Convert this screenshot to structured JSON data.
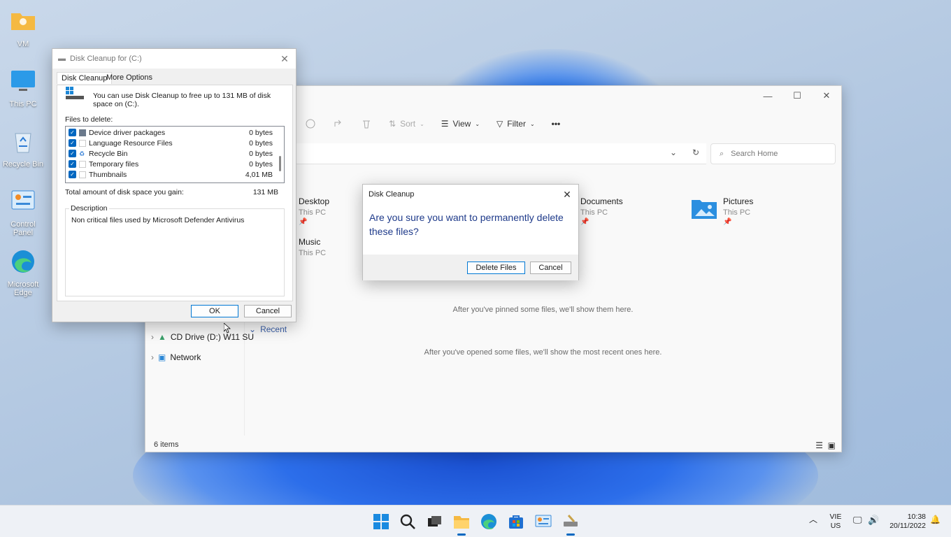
{
  "desktop": {
    "icons": [
      {
        "label": "VM",
        "icon": "folder-icon"
      },
      {
        "label": "This PC",
        "icon": "monitor-icon"
      },
      {
        "label": "Recycle Bin",
        "icon": "recycle-bin-icon"
      },
      {
        "label": "Control Panel",
        "icon": "control-panel-icon"
      },
      {
        "label": "Microsoft Edge",
        "icon": "edge-icon"
      }
    ]
  },
  "explorer": {
    "toolbar": {
      "sort": "Sort",
      "view": "View",
      "filter": "Filter",
      "more": "•••"
    },
    "search_placeholder": "Search Home",
    "nav": {
      "recent": "Recent",
      "cd_drive": "CD Drive (D:) W11 SU",
      "network": "Network"
    },
    "quick_access": [
      {
        "name": "Desktop",
        "location": "This PC"
      },
      {
        "name": "Music",
        "location": "This PC"
      },
      {
        "name": "Documents",
        "location": "This PC"
      },
      {
        "name": "Pictures",
        "location": "This PC"
      }
    ],
    "favorites_empty": "After you've pinned some files, we'll show them here.",
    "recent_empty": "After you've opened some files, we'll show the most recent ones here.",
    "status": "6 items"
  },
  "disk_cleanup": {
    "title": "Disk Cleanup for  (C:)",
    "tabs": [
      "Disk Cleanup",
      "More Options"
    ],
    "intro": "You can use Disk Cleanup to free up to 131 MB of disk space on (C:).",
    "files_label": "Files to delete:",
    "files": [
      {
        "name": "Device driver packages",
        "size": "0 bytes",
        "checked": true
      },
      {
        "name": "Language Resource Files",
        "size": "0 bytes",
        "checked": true
      },
      {
        "name": "Recycle Bin",
        "size": "0 bytes",
        "checked": true
      },
      {
        "name": "Temporary files",
        "size": "0 bytes",
        "checked": true
      },
      {
        "name": "Thumbnails",
        "size": "4,01 MB",
        "checked": true
      }
    ],
    "total_label": "Total amount of disk space you gain:",
    "total_value": "131 MB",
    "description_label": "Description",
    "description_text": "Non critical files used by Microsoft Defender Antivirus",
    "ok": "OK",
    "cancel": "Cancel"
  },
  "confirm": {
    "title": "Disk Cleanup",
    "message": "Are you sure you want to permanently delete these files?",
    "delete": "Delete Files",
    "cancel": "Cancel"
  },
  "taskbar": {
    "lang_top": "VIE",
    "lang_bottom": "US",
    "time": "10:38",
    "date": "20/11/2022"
  },
  "colors": {
    "accent": "#0067c0",
    "prompt_text": "#1e3a8a"
  }
}
